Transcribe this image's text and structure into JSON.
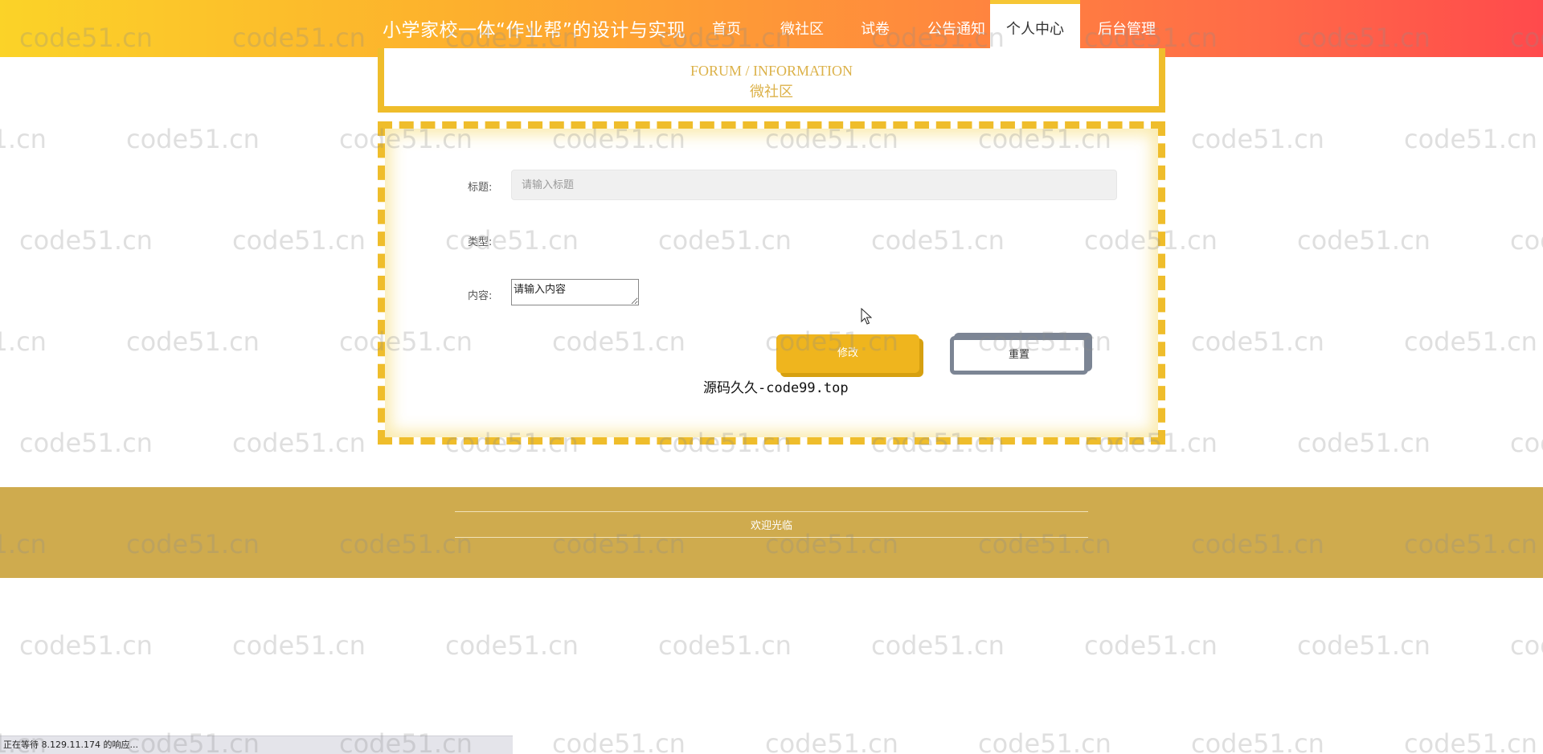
{
  "header": {
    "site_title": "小学家校一体“作业帮”的设计与实现",
    "nav": [
      {
        "label": "首页",
        "active": false
      },
      {
        "label": "微社区",
        "active": false
      },
      {
        "label": "试卷",
        "active": false
      },
      {
        "label": "公告通知",
        "active": false
      },
      {
        "label": "个人中心",
        "active": true
      },
      {
        "label": "后台管理",
        "active": false
      }
    ]
  },
  "section": {
    "title_en": "FORUM / INFORMATION",
    "title_cn": "微社区"
  },
  "form": {
    "title_label": "标题:",
    "title_placeholder": "请输入标题",
    "type_label": "类型:",
    "content_label": "内容:",
    "content_placeholder": "请输入内容",
    "submit_label": "修改",
    "reset_label": "重置"
  },
  "overlay_note": "源码久久-code99.top",
  "footer": {
    "text": "欢迎光临"
  },
  "status_bar": {
    "text": "正在等待 8.129.11.174 的响应..."
  },
  "watermark": "code51.cn",
  "colors": {
    "accent": "#efbd2b",
    "footer_bg": "#cfab4e",
    "header_gradient_start": "#fbd328",
    "header_gradient_end": "#ff4a4c",
    "reset_border": "#7c8594"
  }
}
